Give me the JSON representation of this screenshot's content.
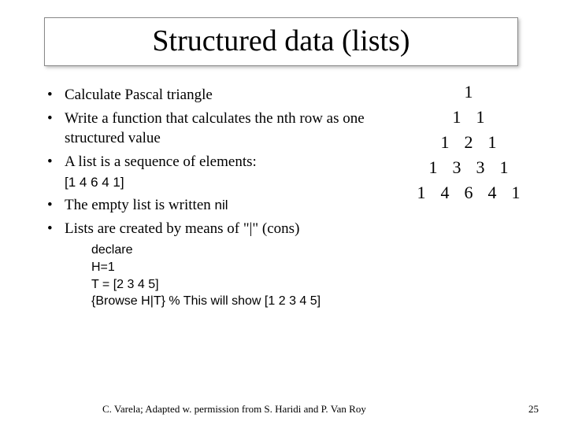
{
  "title": "Structured data (lists)",
  "bullets": {
    "b1": "Calculate Pascal triangle",
    "b2": "Write a function that calculates the nth row as one structured value",
    "b3a": "A list is a sequence of elements:",
    "b3b": "[1 4 6 4 1]",
    "b4a": "The empty list is written ",
    "b4b": "nil",
    "b5a": "Lists are created by means of ",
    "b5b": "\"|\"  (cons)"
  },
  "code": {
    "l1": "declare",
    "l2": "H=1",
    "l3": "T = [2 3 4 5]",
    "l4": "{Browse H|T}   % This will show [1 2 3 4 5]"
  },
  "pascal": {
    "r1": [
      "1"
    ],
    "r2": [
      "1",
      "1"
    ],
    "r3": [
      "1",
      "2",
      "1"
    ],
    "r4": [
      "1",
      "3",
      "3",
      "1"
    ],
    "r5": [
      "1",
      "4",
      "6",
      "4",
      "1"
    ]
  },
  "footer": {
    "attribution": "C. Varela;  Adapted w. permission from S. Haridi and P. Van Roy",
    "page": "25"
  }
}
